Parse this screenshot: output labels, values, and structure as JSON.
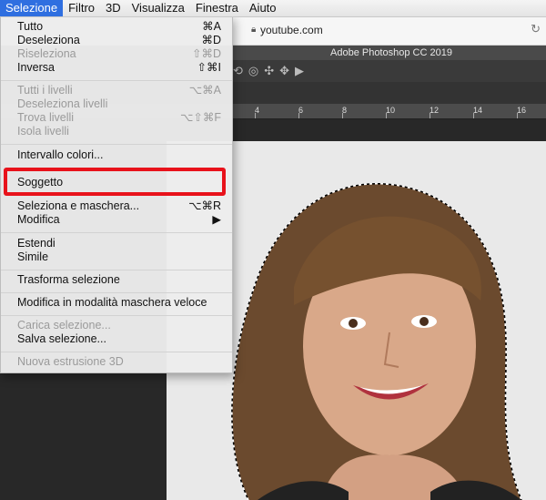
{
  "menubar": {
    "items": [
      {
        "label": "Selezione",
        "active": true
      },
      {
        "label": "Filtro",
        "active": false
      },
      {
        "label": "3D",
        "active": false
      },
      {
        "label": "Visualizza",
        "active": false
      },
      {
        "label": "Finestra",
        "active": false
      },
      {
        "label": "Aiuto",
        "active": false
      }
    ]
  },
  "browser": {
    "url": "youtube.com",
    "lock_icon": "lock-icon",
    "reload_icon": "reload-icon"
  },
  "photoshop": {
    "title": "Adobe Photoshop CC 2019"
  },
  "ruler": {
    "ticks": [
      "4",
      "6",
      "8",
      "10",
      "12",
      "14",
      "16"
    ]
  },
  "menu": {
    "items": [
      {
        "label": "Tutto",
        "shortcut": "⌘A",
        "disabled": false
      },
      {
        "label": "Deseleziona",
        "shortcut": "⌘D",
        "disabled": false
      },
      {
        "label": "Riseleziona",
        "shortcut": "⇧⌘D",
        "disabled": true
      },
      {
        "label": "Inversa",
        "shortcut": "⇧⌘I",
        "disabled": false
      },
      {
        "label": "Tutti i livelli",
        "shortcut": "⌥⌘A",
        "disabled": true
      },
      {
        "label": "Deseleziona livelli",
        "shortcut": "",
        "disabled": true
      },
      {
        "label": "Trova livelli",
        "shortcut": "⌥⇧⌘F",
        "disabled": true
      },
      {
        "label": "Isola livelli",
        "shortcut": "",
        "disabled": true
      },
      {
        "label": "Intervallo colori...",
        "shortcut": "",
        "disabled": false
      },
      {
        "label": "Soggetto",
        "shortcut": "",
        "disabled": false
      },
      {
        "label": "Seleziona e maschera...",
        "shortcut": "⌥⌘R",
        "disabled": false
      },
      {
        "label": "Modifica",
        "shortcut": "▶",
        "disabled": false
      },
      {
        "label": "Estendi",
        "shortcut": "",
        "disabled": false
      },
      {
        "label": "Simile",
        "shortcut": "",
        "disabled": false
      },
      {
        "label": "Trasforma selezione",
        "shortcut": "",
        "disabled": false
      },
      {
        "label": "Modifica in modalità maschera veloce",
        "shortcut": "",
        "disabled": false
      },
      {
        "label": "Carica selezione...",
        "shortcut": "",
        "disabled": true
      },
      {
        "label": "Salva selezione...",
        "shortcut": "",
        "disabled": false
      },
      {
        "label": "Nuova estrusione 3D",
        "shortcut": "",
        "disabled": true
      }
    ],
    "highlighted": "Soggetto",
    "highlight_color": "#e8121b"
  },
  "colors": {
    "menubar_active": "#2f6fe0",
    "canvas_bg": "#e9e9e9"
  }
}
